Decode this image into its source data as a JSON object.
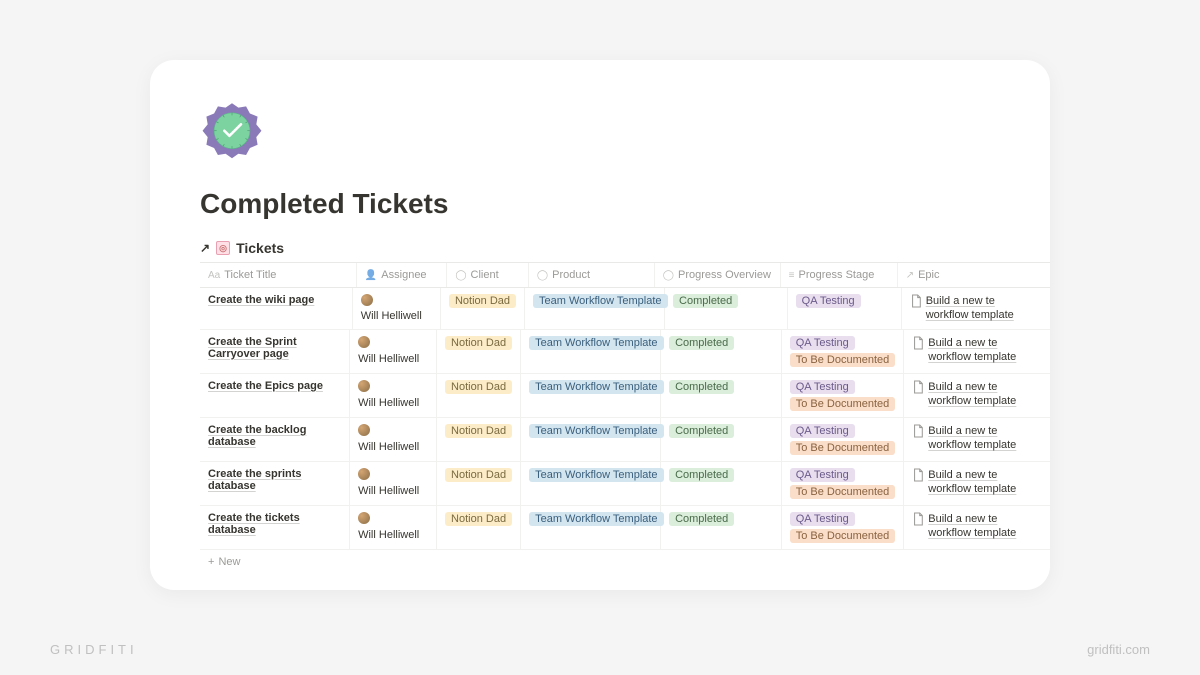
{
  "watermark": {
    "left": "GRIDFITI",
    "right": "gridfiti.com"
  },
  "page": {
    "title": "Completed Tickets",
    "linked_db": "Tickets",
    "new_label": "New"
  },
  "columns": {
    "title": "Ticket Title",
    "assignee": "Assignee",
    "client": "Client",
    "product": "Product",
    "progress": "Progress Overview",
    "stage": "Progress Stage",
    "epic": "Epic"
  },
  "rows": [
    {
      "title": "Create the wiki page",
      "assignee": "Will Helliwell",
      "client": "Notion Dad",
      "product": "Team Workflow Template",
      "progress": "Completed",
      "stages": [
        "QA Testing"
      ],
      "epic_line1": "Build a new te",
      "epic_line2": "workflow template"
    },
    {
      "title": "Create the Sprint Carryover page",
      "assignee": "Will Helliwell",
      "client": "Notion Dad",
      "product": "Team Workflow Template",
      "progress": "Completed",
      "stages": [
        "QA Testing",
        "To Be Documented"
      ],
      "epic_line1": "Build a new te",
      "epic_line2": "workflow template"
    },
    {
      "title": "Create the Epics page",
      "assignee": "Will Helliwell",
      "client": "Notion Dad",
      "product": "Team Workflow Template",
      "progress": "Completed",
      "stages": [
        "QA Testing",
        "To Be Documented"
      ],
      "epic_line1": "Build a new te",
      "epic_line2": "workflow template"
    },
    {
      "title": "Create the backlog database",
      "assignee": "Will Helliwell",
      "client": "Notion Dad",
      "product": "Team Workflow Template",
      "progress": "Completed",
      "stages": [
        "QA Testing",
        "To Be Documented"
      ],
      "epic_line1": "Build a new te",
      "epic_line2": "workflow template"
    },
    {
      "title": "Create the sprints database",
      "assignee": "Will Helliwell",
      "client": "Notion Dad",
      "product": "Team Workflow Template",
      "progress": "Completed",
      "stages": [
        "QA Testing",
        "To Be Documented"
      ],
      "epic_line1": "Build a new te",
      "epic_line2": "workflow template"
    },
    {
      "title": "Create the tickets database",
      "assignee": "Will Helliwell",
      "client": "Notion Dad",
      "product": "Team Workflow Template",
      "progress": "Completed",
      "stages": [
        "QA Testing",
        "To Be Documented"
      ],
      "epic_line1": "Build a new te",
      "epic_line2": "workflow template"
    }
  ]
}
